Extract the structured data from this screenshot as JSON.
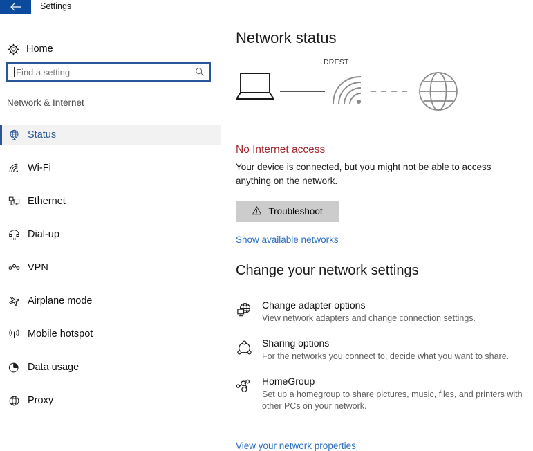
{
  "window": {
    "title": "Settings",
    "back_icon": "back-arrow-icon"
  },
  "sidebar": {
    "home": {
      "label": "Home",
      "icon": "gear-icon"
    },
    "search": {
      "placeholder": "Find a setting",
      "value": "",
      "icon": "search-icon"
    },
    "category": "Network & Internet",
    "items": [
      {
        "label": "Status",
        "icon": "globe-icon",
        "selected": true
      },
      {
        "label": "Wi-Fi",
        "icon": "wifi-icon",
        "selected": false
      },
      {
        "label": "Ethernet",
        "icon": "ethernet-icon",
        "selected": false
      },
      {
        "label": "Dial-up",
        "icon": "dialup-icon",
        "selected": false
      },
      {
        "label": "VPN",
        "icon": "vpn-icon",
        "selected": false
      },
      {
        "label": "Airplane mode",
        "icon": "airplane-icon",
        "selected": false
      },
      {
        "label": "Mobile hotspot",
        "icon": "hotspot-icon",
        "selected": false
      },
      {
        "label": "Data usage",
        "icon": "pie-chart-icon",
        "selected": false
      },
      {
        "label": "Proxy",
        "icon": "globe-icon",
        "selected": false
      }
    ]
  },
  "main": {
    "page_title": "Network status",
    "diagram": {
      "device_icon": "laptop-icon",
      "link1_style": "solid",
      "network_icon": "wifi-signal-icon",
      "network_name": "DREST",
      "link2_style": "dashed",
      "internet_icon": "globe-icon"
    },
    "status": {
      "headline": "No Internet access",
      "description": "Your device is connected, but you might not be able to access anything on the network.",
      "headline_color": "#a4262c"
    },
    "troubleshoot_button": {
      "label": "Troubleshoot",
      "icon": "warning-triangle-icon"
    },
    "show_networks_link": "Show available networks",
    "section_title": "Change your network settings",
    "settings": [
      {
        "title": "Change adapter options",
        "description": "View network adapters and change connection settings.",
        "icon": "network-adapter-icon"
      },
      {
        "title": "Sharing options",
        "description": "For the networks you connect to, decide what you want to share.",
        "icon": "sharing-icon"
      },
      {
        "title": "HomeGroup",
        "description": "Set up a homegroup to share pictures, music, files, and printers with other PCs on your network.",
        "icon": "homegroup-icon"
      }
    ],
    "view_properties_link": "View your network properties"
  },
  "colors": {
    "accent": "#2b5797",
    "titlebar_blue": "#0b4a9c",
    "error_red": "#a4262c",
    "link_blue": "#2b6fbf",
    "button_gray": "#cccccc"
  }
}
